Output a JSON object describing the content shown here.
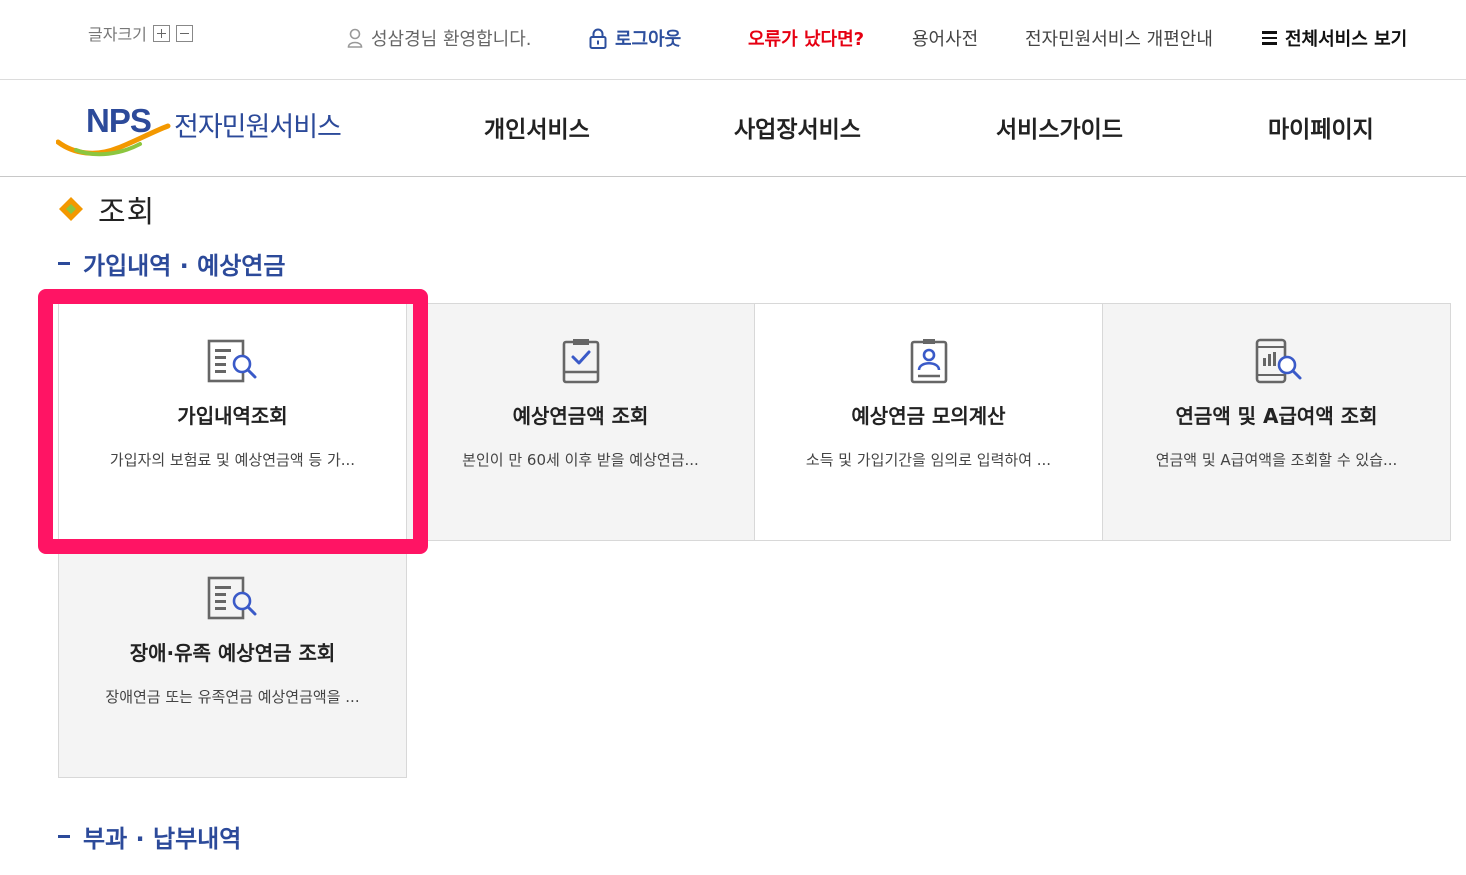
{
  "utility": {
    "font_size_label": "글자크기",
    "welcome": "성삼경님 환영합니다.",
    "logout": "로그아웃",
    "error_report": "오류가 났다면?",
    "dictionary": "용어사전",
    "renewal_notice": "전자민원서비스 개편안내",
    "all_services": "전체서비스 보기"
  },
  "header": {
    "logo_mark": "NPS",
    "logo_text": "전자민원서비스",
    "nav": [
      "개인서비스",
      "사업장서비스",
      "서비스가이드",
      "마이페이지"
    ]
  },
  "page": {
    "title": "조회",
    "sections": [
      {
        "title": "가입내역 · 예상연금",
        "cards": [
          {
            "title": "가입내역조회",
            "desc": "가입자의 보험료 및 예상연금액 등 가...",
            "icon": "document-search-icon"
          },
          {
            "title": "예상연금액 조회",
            "desc": "본인이 만 60세 이후 받을 예상연금...",
            "icon": "clipboard-check-icon"
          },
          {
            "title": "예상연금 모의계산",
            "desc": "소득 및 가입기간을 임의로 입력하여 ...",
            "icon": "id-card-person-icon"
          },
          {
            "title": "연금액 및 A급여액 조회",
            "desc": "연금액 및 A급여액을 조회할 수 있습...",
            "icon": "tablet-chart-search-icon"
          },
          {
            "title": "장애·유족 예상연금 조회",
            "desc": "장애연금 또는 유족연금 예상연금액을 ...",
            "icon": "document-search-icon"
          }
        ]
      },
      {
        "title": "부과 · 납부내역"
      }
    ]
  },
  "colors": {
    "brand_blue": "#2c4a9a",
    "error_red": "#e60012",
    "highlight": "#ff1464",
    "card_bg": "#f4f4f4"
  }
}
